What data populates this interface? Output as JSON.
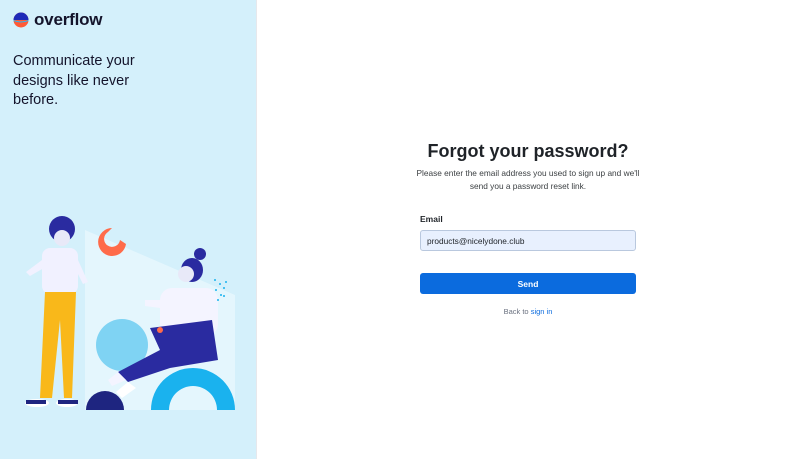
{
  "brand": {
    "name": "overflow",
    "tagline": "Communicate your designs like never before."
  },
  "form": {
    "title": "Forgot your password?",
    "subtitle": "Please enter the email address you used to sign up and we'll send you a password reset link.",
    "email_label": "Email",
    "email_value": "products@nicelydone.club",
    "send_label": "Send",
    "back_prefix": "Back to",
    "sign_in_link": "sign in"
  },
  "colors": {
    "left_panel_bg": "#d4f0fb",
    "primary": "#0b6bde",
    "input_bg": "#e8f0fe"
  }
}
